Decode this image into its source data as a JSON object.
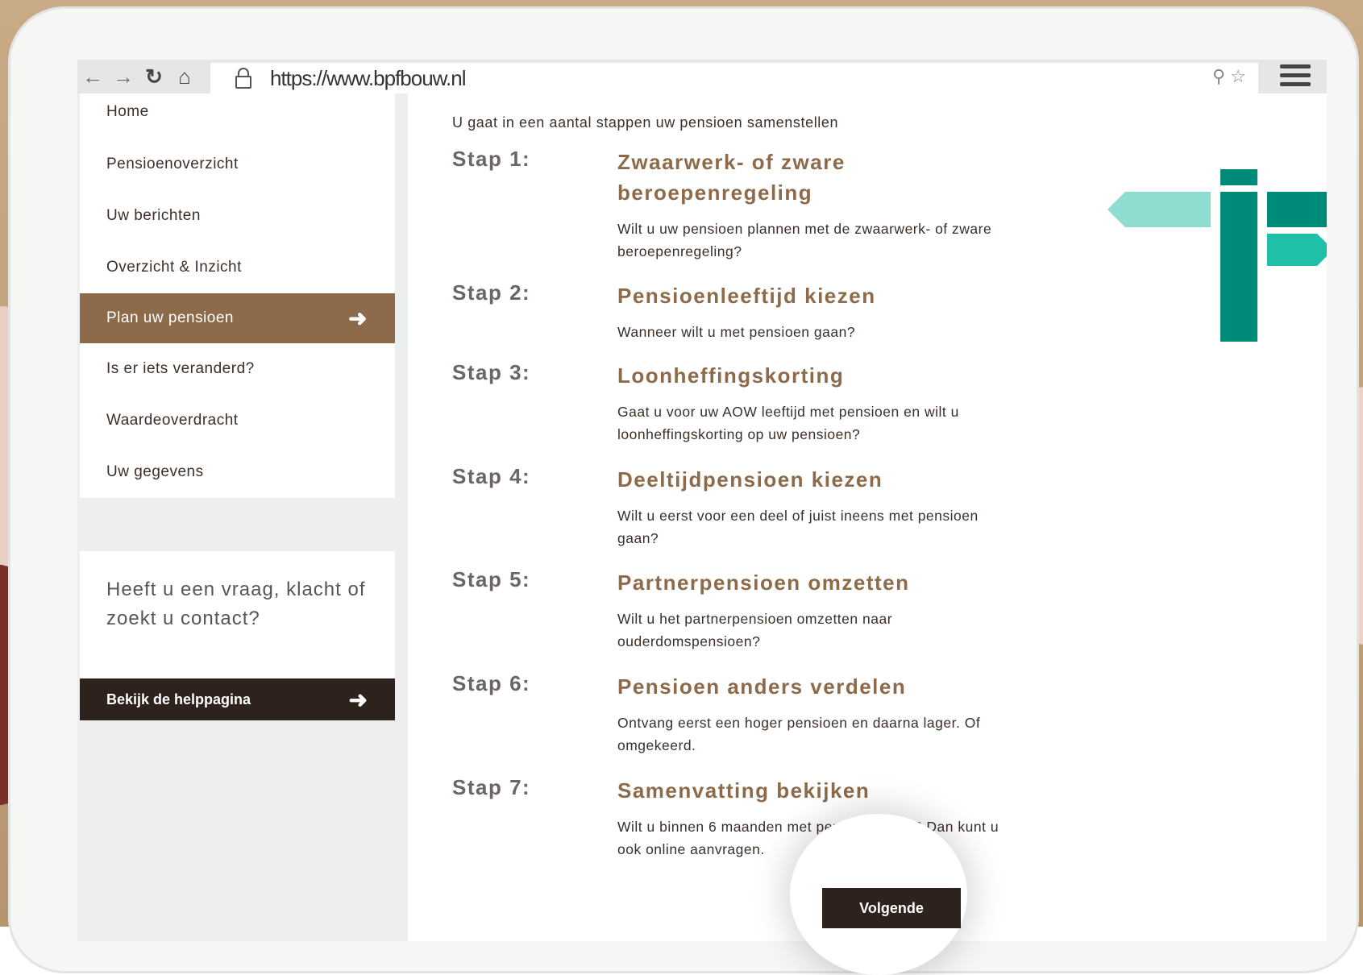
{
  "browser": {
    "url": "https://www.bpfbouw.nl",
    "icons": [
      "back-arrow-icon",
      "forward-arrow-icon",
      "reload-icon",
      "home-icon",
      "lock-icon",
      "zoom-icon",
      "star-icon",
      "hamburger-menu-icon"
    ]
  },
  "sidebar": {
    "items": [
      {
        "label": "Home"
      },
      {
        "label": "Pensioenoverzicht"
      },
      {
        "label": "Uw berichten"
      },
      {
        "label": "Overzicht & Inzicht"
      },
      {
        "label": "Plan uw pensioen",
        "active": true
      },
      {
        "label": "Is er iets veranderd?"
      },
      {
        "label": "Waardeoverdracht"
      },
      {
        "label": "Uw gegevens"
      }
    ],
    "help_text": "Heeft u een vraag, klacht of zoekt u contact?",
    "help_button": "Bekijk de helppagina"
  },
  "main": {
    "intro": "U gaat in een aantal stappen uw pensioen samenstellen",
    "steps": [
      {
        "num": "Stap 1:",
        "title": "Zwaarwerk- of zware beroepenregeling",
        "desc": "Wilt u uw pensioen plannen met de zwaarwerk- of zware beroepenregeling?"
      },
      {
        "num": "Stap 2:",
        "title": "Pensioenleeftijd kiezen",
        "desc": "Wanneer wilt u met pensioen gaan?"
      },
      {
        "num": "Stap 3:",
        "title": "Loonheffingskorting",
        "desc": "Gaat u voor uw AOW leeftijd met pensioen en wilt u loonheffingskorting op uw pensioen?"
      },
      {
        "num": "Stap 4:",
        "title": "Deeltijdpensioen kiezen",
        "desc": "Wilt u eerst voor een deel of juist ineens met pensioen gaan?"
      },
      {
        "num": "Stap 5:",
        "title": "Partnerpensioen omzetten",
        "desc": "Wilt u het partnerpensioen omzetten naar ouderdomspensioen?"
      },
      {
        "num": "Stap 6:",
        "title": "Pensioen anders verdelen",
        "desc": "Ontvang eerst een hoger pensioen en daarna lager. Of omgekeerd."
      },
      {
        "num": "Stap 7:",
        "title": "Samenvatting bekijken",
        "desc": "Wilt u binnen 6 maanden met pensioen gaan? Dan kunt u ook online aanvragen."
      }
    ],
    "next_button": "Volgende"
  },
  "colors": {
    "accent_brown": "#8c6a4a",
    "dark_button": "#2d221c",
    "sign_teal_dark": "#008a78",
    "sign_teal_light": "#8fdcd1",
    "sign_teal_mid": "#1fbfa8"
  }
}
